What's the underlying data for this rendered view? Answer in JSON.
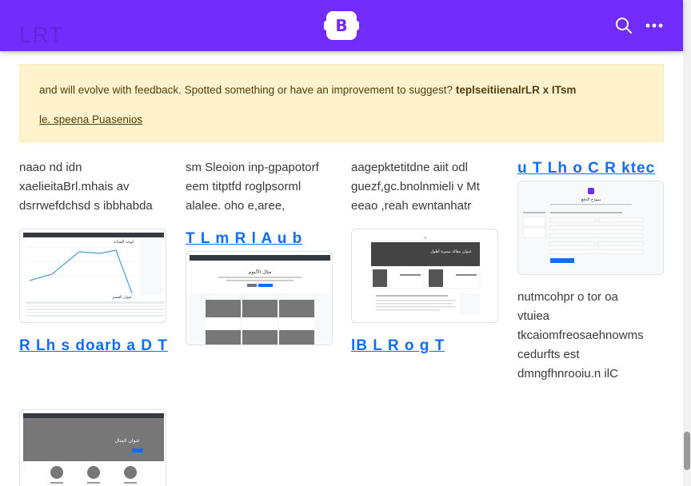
{
  "header": {
    "ghost_title": "LRT",
    "brand_letter": "B",
    "search_icon": "search-icon",
    "more_icon": "more-horizontal-icon",
    "color": "#712cf9"
  },
  "alert": {
    "text": "and will evolve with feedback. Spotted something or have an improvement to suggest?",
    "strong": "teplseitiienalrLR x ITsm",
    "link": "le. speena Puasenios",
    "bg_color": "#fff3cd"
  },
  "columns": [
    {
      "desc": [
        "naao nd idn",
        "xaelieitaBrl.mhais av",
        "dsrrwefdchsd s ibbhabda"
      ],
      "title": "R Lh s doarb a D T"
    },
    {
      "desc": [
        "sm Sleoion inp-gpapotorf",
        "eem titptfd roglpsorml",
        "alalee. oho e,aree,"
      ],
      "title": "T L m R l A u b"
    },
    {
      "desc": [
        "aagepktetitdne aiit odl",
        "guezf,gc.bnolnmieli v Mt",
        "eeao ,reah ewntanhatr"
      ],
      "title": "lB L R o g T"
    },
    {
      "desc": [
        "nutmcohpr o tor oa",
        "vtuiea",
        "tkcaiomfreosaehnowms",
        "cedurfts est",
        "dmngfhnrooiu.n ilC"
      ],
      "title": "u T Lh o C R ktec"
    }
  ],
  "previews": {
    "dashboard_title": "لوحة القيادة",
    "dashboard_subtitle": "عنوان القسم",
    "album_title": "مثال الألبوم",
    "blog_title": "عنوان مقالة مميزة أطول",
    "checkout_title": "نموذج الدفع",
    "carousel_title": "عنوان المثال",
    "link_color": "#0d6efd"
  }
}
